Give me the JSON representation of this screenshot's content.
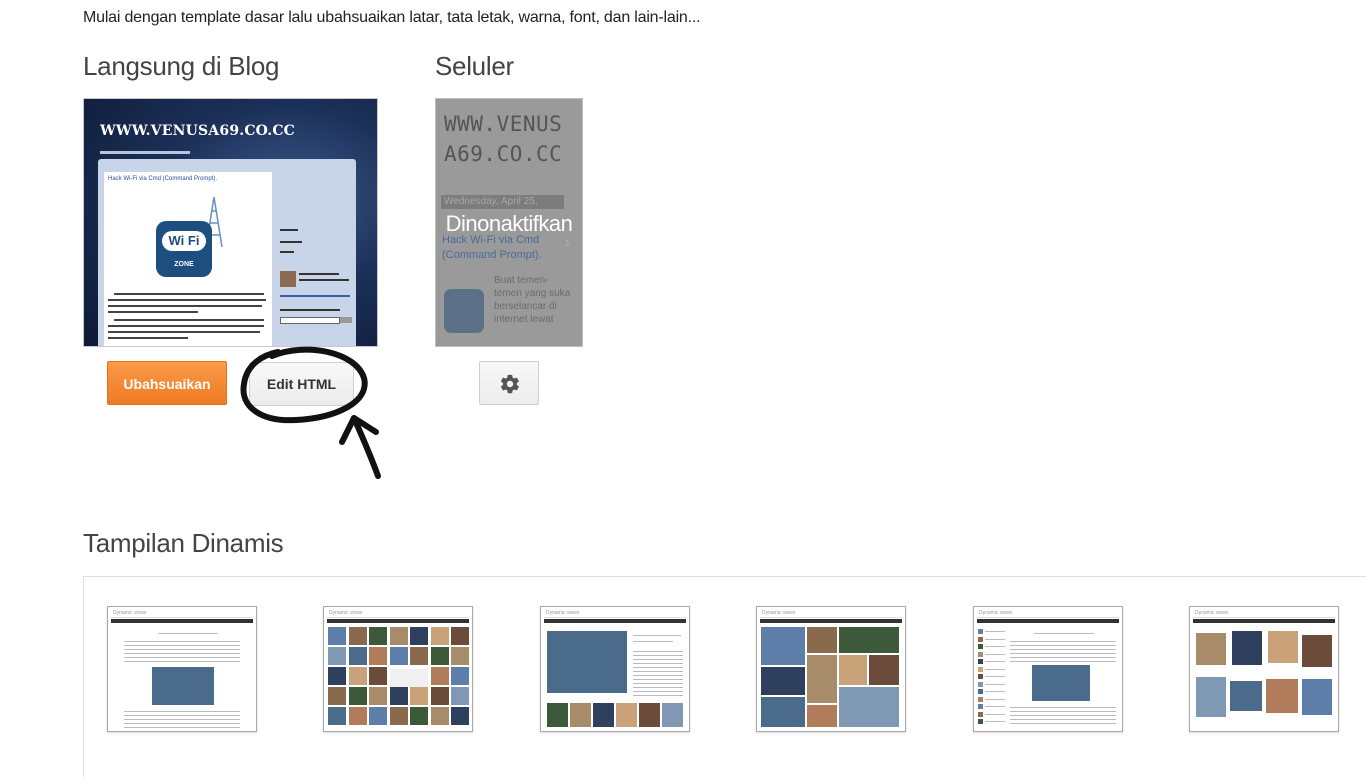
{
  "intro": "Mulai dengan template dasar lalu ubahsuaikan latar, tata letak, warna, font, dan lain-lain...",
  "live_blog": {
    "title": "Langsung di Blog",
    "site_title": "WWW.VENUSA69.CO.CC",
    "post_title": "Hack Wi-Fi via Cmd (Command Prompt).",
    "logo_text": "Wi Fi",
    "logo_subtext": "ZONE",
    "customize_label": "Ubahsuaikan",
    "edit_html_label": "Edit HTML"
  },
  "mobile": {
    "title": "Seluler",
    "site_title": "WWW.VENUS A69.CO.CC",
    "date": "Wednesday, April 25,",
    "post_title": "Hack Wi-Fi via Cmd (Command Prompt).",
    "body": "Buat temen-temen yang suka berselancar di internet lewat",
    "overlay_label": "Dinonaktifkan",
    "settings_icon": "gear-icon"
  },
  "dynamic": {
    "title": "Tampilan Dinamis",
    "thumb_label": "Dynamic views",
    "thumbs": [
      "classic",
      "flipcard",
      "magazine",
      "mosaic",
      "sidebar",
      "snapshot"
    ]
  },
  "colors": {
    "accent_orange": "#f58833",
    "blog_bg": "#1b2f57"
  }
}
